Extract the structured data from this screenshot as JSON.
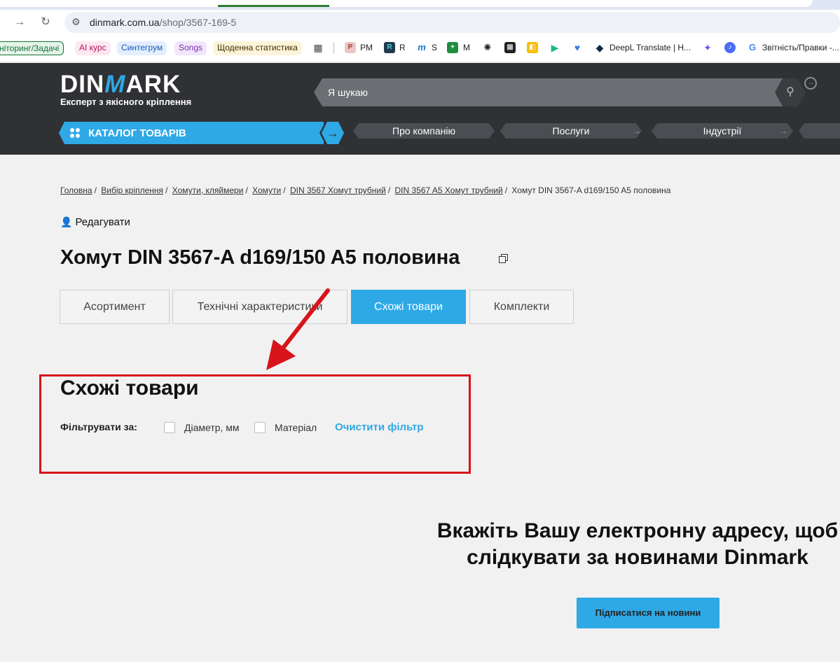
{
  "browser": {
    "url_host": "dinmark.com.ua",
    "url_path": "/shop/3567-169-5",
    "bookmarks": [
      {
        "label": "ніторинг/Задачі",
        "bg": "#e6f4ea",
        "color": "#137333"
      },
      {
        "label": "AI курс",
        "bg": "#fde7f1",
        "color": "#b3135f"
      },
      {
        "label": "Синтегрум",
        "bg": "#e3efff",
        "color": "#1a57b5"
      },
      {
        "label": "Songs",
        "bg": "#f1e6fb",
        "color": "#7b2fb2"
      },
      {
        "label": "Щоденна статистика",
        "bg": "#fdf4d9",
        "color": "#3a2f00"
      },
      {
        "label": "PM"
      },
      {
        "label": "R"
      },
      {
        "label": "S"
      },
      {
        "label": "M"
      },
      {
        "label": "DeepL Translate | H..."
      },
      {
        "label": "Звітність/Правки -..."
      }
    ]
  },
  "header": {
    "logo_left": "DIN",
    "logo_mid": "M",
    "logo_right": "ARK",
    "tagline": "Експерт з якісного кріплення",
    "search_placeholder": "Я шукаю",
    "catalog_label": "КАТАЛОГ ТОВАРІВ",
    "menu": [
      "Про компанію",
      "Послуги",
      "Індустрії"
    ]
  },
  "breadcrumb": [
    "Головна",
    "Вибір кріплення",
    "Хомути, кляймери",
    "Хомути",
    "DIN 3567 Хомут трубний",
    "DIN 3567 A5 Хомут трубний",
    "Хомут DIN 3567-A d169/150 A5 половина"
  ],
  "edit_label": "Редагувати",
  "product_title": "Хомут DIN 3567-A d169/150 A5 половина",
  "tabs": [
    "Асортимент",
    "Технічні характеристики",
    "Схожі товари",
    "Комплекти"
  ],
  "similar": {
    "title": "Схожі товари",
    "filter_label": "Фільтрувати за:",
    "filters": [
      "Діаметр, мм",
      "Матеріал"
    ],
    "clear_label": "Очистити фільтр"
  },
  "subscribe": {
    "line1": "Вкажіть Вашу електронну адресу, щоб",
    "line2": "слідкувати за новинами Dinmark",
    "button": "Підписатися на новини"
  },
  "colors": {
    "accent": "#2ea9e6",
    "header_bg": "#2f3134",
    "annotation": "#d7141a"
  }
}
